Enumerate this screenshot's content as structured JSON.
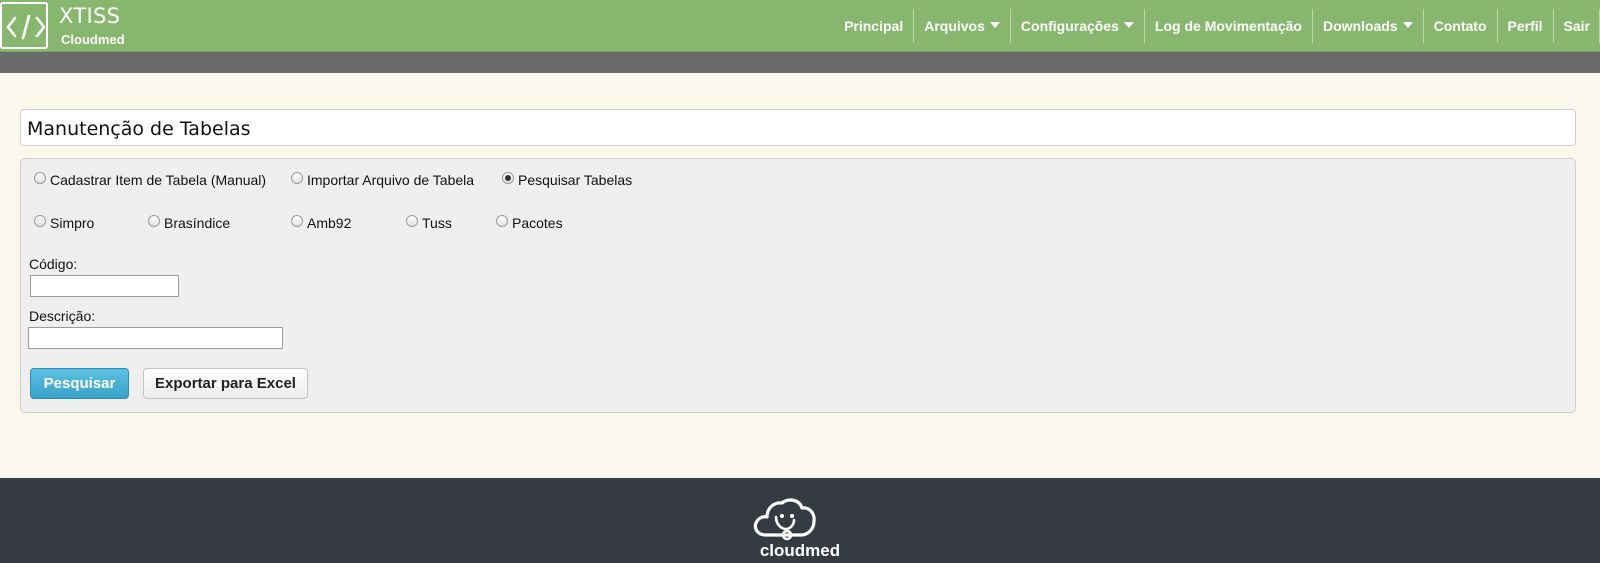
{
  "header": {
    "title": "XTISS",
    "subtitle": "Cloudmed",
    "logo_icon": "code-brackets-icon",
    "bg_color": "#87b76e",
    "nav": [
      {
        "label": "Principal",
        "has_dropdown": false
      },
      {
        "label": "Arquivos",
        "has_dropdown": true
      },
      {
        "label": "Configurações",
        "has_dropdown": true
      },
      {
        "label": "Log de Movimentação",
        "has_dropdown": false
      },
      {
        "label": "Downloads",
        "has_dropdown": true
      },
      {
        "label": "Contato",
        "has_dropdown": false
      },
      {
        "label": "Perfil",
        "has_dropdown": false
      },
      {
        "label": "Sair",
        "has_dropdown": false
      }
    ]
  },
  "page": {
    "title": "Manutenção de Tabelas"
  },
  "form": {
    "mode_options": [
      {
        "label": "Cadastrar Item de Tabela (Manual)",
        "checked": false
      },
      {
        "label": "Importar Arquivo de Tabela",
        "checked": false
      },
      {
        "label": "Pesquisar Tabelas",
        "checked": true
      }
    ],
    "table_options": [
      {
        "label": "Simpro",
        "checked": false
      },
      {
        "label": "Brasíndice",
        "checked": false
      },
      {
        "label": "Amb92",
        "checked": false
      },
      {
        "label": "Tuss",
        "checked": false
      },
      {
        "label": "Pacotes",
        "checked": false
      }
    ],
    "codigo_label": "Código:",
    "codigo_value": "",
    "descricao_label": "Descrição:",
    "descricao_value": "",
    "search_button": "Pesquisar",
    "export_button": "Exportar para Excel",
    "primary_color": "#3aa1c8"
  },
  "footer": {
    "logo_icon": "cloud-stethoscope-icon",
    "brand": "cloudmed",
    "bg_color": "#363a42"
  }
}
